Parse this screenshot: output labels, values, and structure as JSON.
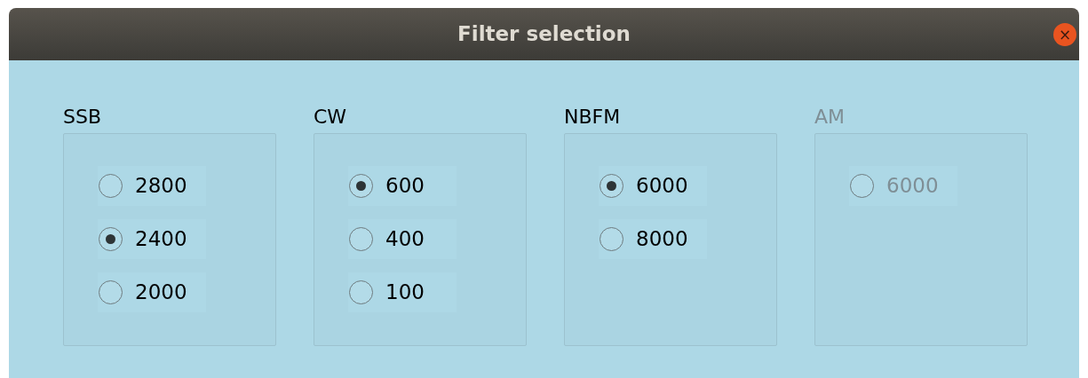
{
  "window": {
    "title": "Filter selection",
    "close": "×"
  },
  "groups": [
    {
      "label": "SSB",
      "disabled": false,
      "options": [
        {
          "label": "2800",
          "selected": false
        },
        {
          "label": "2400",
          "selected": true
        },
        {
          "label": "2000",
          "selected": false
        }
      ]
    },
    {
      "label": "CW",
      "disabled": false,
      "options": [
        {
          "label": "600",
          "selected": true
        },
        {
          "label": "400",
          "selected": false
        },
        {
          "label": "100",
          "selected": false
        }
      ]
    },
    {
      "label": "NBFM",
      "disabled": false,
      "options": [
        {
          "label": "6000",
          "selected": true
        },
        {
          "label": "8000",
          "selected": false
        }
      ]
    },
    {
      "label": "AM",
      "disabled": true,
      "options": [
        {
          "label": "6000",
          "selected": false
        }
      ]
    }
  ]
}
